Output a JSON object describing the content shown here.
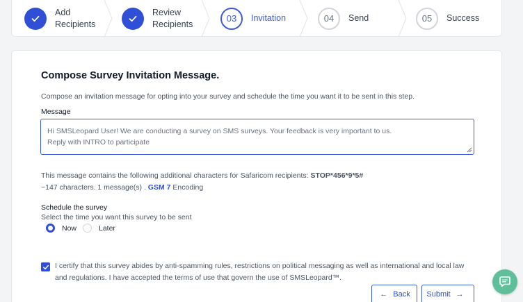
{
  "stepper": {
    "steps": [
      {
        "label_line1": "Add",
        "label_line2": "Recipients",
        "status": "done"
      },
      {
        "label_line1": "Review",
        "label_line2": "Recipients",
        "status": "done"
      },
      {
        "number": "03",
        "label": "Invitation",
        "status": "current"
      },
      {
        "number": "04",
        "label": "Send",
        "status": "todo"
      },
      {
        "number": "05",
        "label": "Success",
        "status": "todo"
      }
    ]
  },
  "form": {
    "title": "Compose Survey Invitation Message.",
    "intro": "Compose an invitation message for opting into your survey and schedule the time you want it to be sent in this step.",
    "message_label": "Message",
    "message_line1": "Hi SMSLeopard User! We are conducting a survey on SMS surveys. Your feedback is very important to us.",
    "message_line2": "Reply with INTRO to participate",
    "info_prefix": "This message contains the following additional characters for Safaricom recipients:",
    "info_code": "STOP*456*9*5#",
    "count_text": "~147 characters. 1 message(s) .",
    "encoding_link": "GSM 7",
    "encoding_suffix": "Encoding",
    "schedule_label": "Schedule the survey",
    "schedule_sub": "Select the time you want this survey to be sent",
    "option_now": "Now",
    "option_later": "Later",
    "selected_option": "Now",
    "certify_checked": true,
    "certify_text": "I certify that this survey abides by anti-spamming rules, restrictions on political messaging as well as international and local law and regulations. I have accepted the terms of use that govern the use of SMSLeopard™.",
    "back_label": "Back",
    "submit_label": "Submit"
  },
  "colors": {
    "primary": "#2f4fd6",
    "chat_fab": "#5fbf9a"
  }
}
